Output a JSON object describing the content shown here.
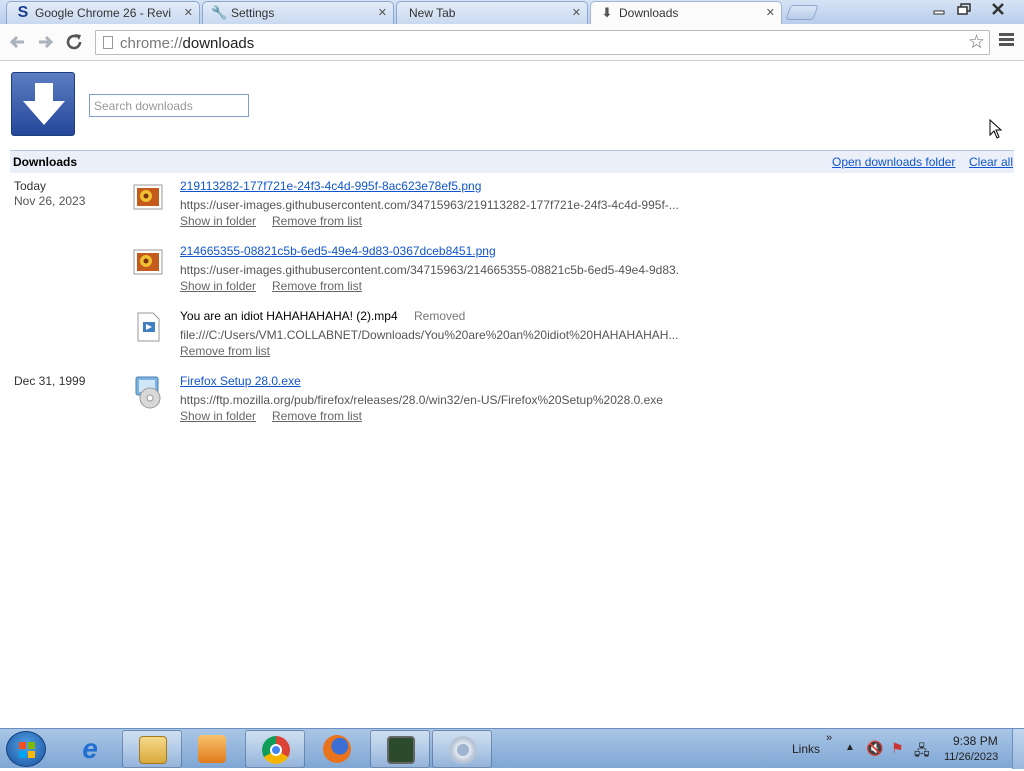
{
  "tabs": [
    {
      "title": "Google Chrome 26 - Revi",
      "icon": "s-logo-icon"
    },
    {
      "title": "Settings",
      "icon": "wrench-icon"
    },
    {
      "title": "New Tab",
      "icon": "none"
    },
    {
      "title": "Downloads",
      "icon": "download-arrow-icon"
    }
  ],
  "toolbar": {
    "url_scheme": "chrome://",
    "url_path": "downloads"
  },
  "search": {
    "placeholder": "Search downloads"
  },
  "header": {
    "title": "Downloads",
    "open_folder": "Open downloads folder",
    "clear_all": "Clear all"
  },
  "groups": [
    {
      "label": "Today",
      "date": "Nov 26, 2023"
    },
    {
      "label": "Dec 31, 1999"
    }
  ],
  "downloads": [
    {
      "name": "219113282-177f721e-24f3-4c4d-995f-8ac623e78ef5.png",
      "url": "https://user-images.githubusercontent.com/34715963/219113282-177f721e-24f3-4c4d-995f-...",
      "actions": [
        "Show in folder",
        "Remove from list"
      ]
    },
    {
      "name": "214665355-08821c5b-6ed5-49e4-9d83-0367dceb8451.png",
      "url": "https://user-images.githubusercontent.com/34715963/214665355-08821c5b-6ed5-49e4-9d83...",
      "actions": [
        "Show in folder",
        "Remove from list"
      ]
    },
    {
      "name": "You are an idiot HAHAHAHAHA! (2).mp4",
      "status": "Removed",
      "url": "file:///C:/Users/VM1.COLLABNET/Downloads/You%20are%20an%20idiot%20HAHAHAHAH...",
      "actions": [
        "Remove from list"
      ]
    },
    {
      "name": "Firefox Setup 28.0.exe",
      "url": "https://ftp.mozilla.org/pub/firefox/releases/28.0/win32/en-US/Firefox%20Setup%2028.0.exe",
      "actions": [
        "Show in folder",
        "Remove from list"
      ]
    }
  ],
  "taskbar": {
    "links_label": "Links",
    "time": "9:38 PM",
    "date": "11/26/2023"
  }
}
